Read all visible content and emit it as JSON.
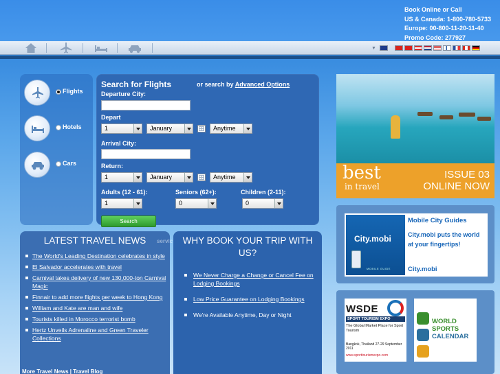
{
  "header": {
    "contact": {
      "line1": "Book Online or Call",
      "line2": "US & Canada: 1-800-780-5733",
      "line3": "Europe: 00-800-11-20-11-40",
      "line4": "Promo Code: 277927"
    },
    "nav_icons": [
      "home-icon",
      "plane-icon",
      "bed-icon",
      "car-icon"
    ],
    "flags": [
      {
        "name": "uk-flag",
        "color": "#1f3c8a"
      },
      {
        "name": "china-flag",
        "color": "#d7261e"
      },
      {
        "name": "taiwan-flag",
        "color": "#d8201c"
      },
      {
        "name": "austria-flag",
        "color": "#d92c2c"
      },
      {
        "name": "netherlands-flag",
        "color": "#b5233a"
      },
      {
        "name": "usa-flag",
        "color": "#3c4f8f"
      },
      {
        "name": "finland-flag",
        "color": "#ffffff"
      },
      {
        "name": "france-flag",
        "color": "#2850a0"
      },
      {
        "name": "canada-flag",
        "color": "#d52b1e"
      },
      {
        "name": "germany-flag",
        "color": "#ffcc00"
      }
    ]
  },
  "modes": [
    {
      "label": "Flights",
      "icon": "plane-icon",
      "checked": true
    },
    {
      "label": "Hotels",
      "icon": "bed-icon",
      "checked": false
    },
    {
      "label": "Cars",
      "icon": "car-icon",
      "checked": false
    }
  ],
  "search": {
    "title": "Search for Flights",
    "advanced_prefix": "or search by",
    "advanced_link": "Advanced Options",
    "departure_label": "Departure City:",
    "depart_label": "Depart",
    "depart_day": "1",
    "depart_month": "January",
    "depart_time": "Anytime",
    "arrival_label": "Arrival City:",
    "return_label": "Return:",
    "return_day": "1",
    "return_month": "January",
    "return_time": "Anytime",
    "adults_label": "Adults (12 - 61):",
    "adults_value": "1",
    "seniors_label": "Seniors (62+):",
    "seniors_value": "0",
    "children_label": "Children (2-11):",
    "children_value": "0",
    "button": "Search"
  },
  "news": {
    "heading": "LATEST TRAVEL NEWS",
    "items": [
      "The World's Leading Destination celebrates in style",
      "El Salvador accelerates with travel",
      "Carnival takes delivery of new 130,000-ton Carnival Magic",
      "Finnair to add more flights per week to Hong Kong",
      "William and Kate are man and wife",
      "Tourists killed in Morocco terrorist bomb",
      "Hertz Unveils Adrenaline and Green Traveler Collections"
    ],
    "more": "More Travel News | Travel Blog"
  },
  "why": {
    "heading": "WHY BOOK YOUR TRIP WITH US?",
    "ghost": "servic",
    "items": [
      {
        "text": "We Never Charge a Change or Cancel Fee on Lodging Bookings",
        "link": true
      },
      {
        "text": "Low Price Guarantee on Lodging Bookings",
        "link": true
      },
      {
        "text": "We're Available Anytime, Day or Night",
        "link": false
      }
    ]
  },
  "ads": {
    "best": {
      "brand_big": "best",
      "brand_small": "in travel",
      "issue_line1": "ISSUE 03",
      "issue_line2": "ONLINE NOW"
    },
    "city": {
      "logo_text": "City.mobi",
      "logo_sub": "MOBILE GUIDE",
      "title": "Mobile City Guides",
      "body": "City.mobi puts the world at your fingertips!",
      "link": "City.mobi"
    },
    "wsde": {
      "big": "WSDE",
      "sub": "SPORT TOURISM EXPO",
      "tagline": "The Global Market Place for Sport Tourism",
      "location": "Bangkok, Thailand 27-29 September 2011",
      "url": "www.sporttourismexpo.com"
    },
    "wsc": {
      "line1": "WORLD",
      "line2": "SPORTS",
      "line3": "CALENDAR"
    }
  }
}
